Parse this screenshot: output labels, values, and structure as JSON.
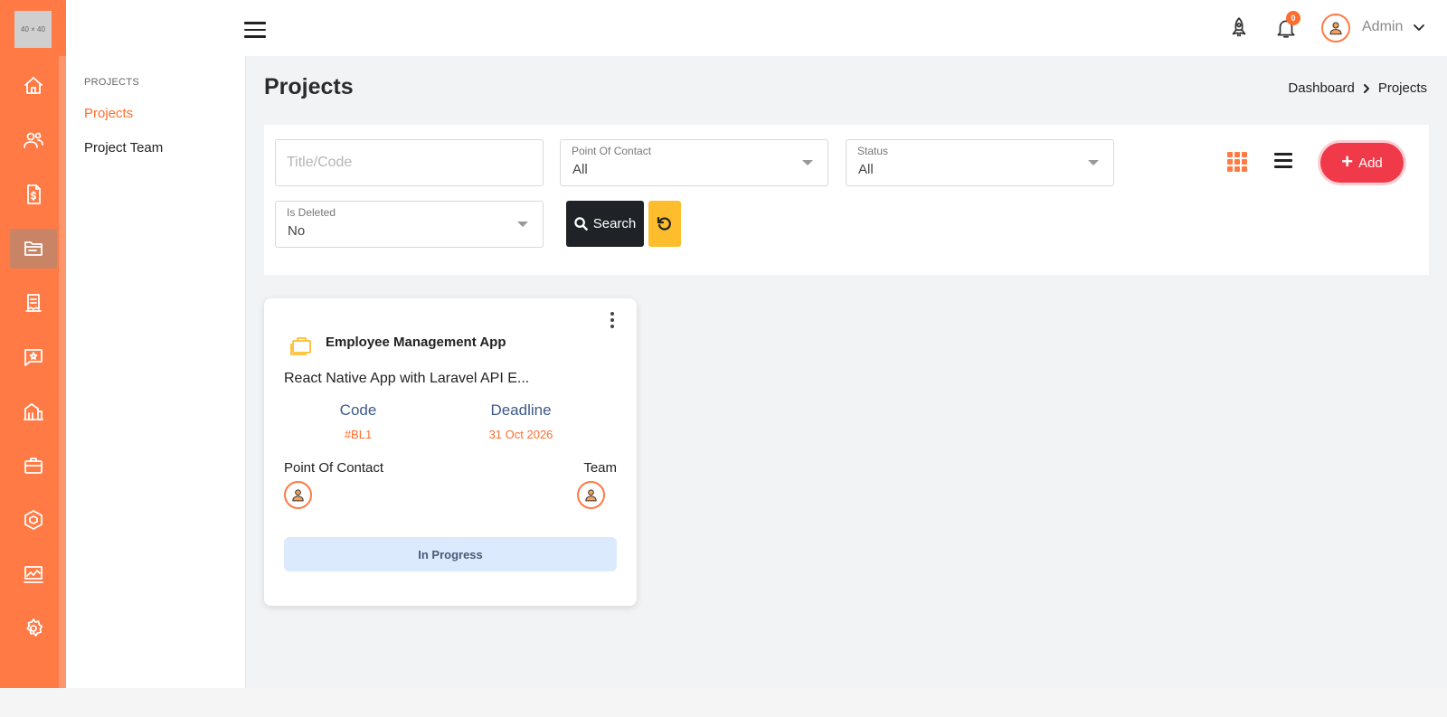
{
  "logo": {
    "text": "40 × 40"
  },
  "rail": {
    "items": [
      {
        "icon": "home-icon"
      },
      {
        "icon": "users-icon"
      },
      {
        "icon": "invoice-icon"
      },
      {
        "icon": "folder-icon"
      },
      {
        "icon": "receipt-icon"
      },
      {
        "icon": "message-icon"
      },
      {
        "icon": "building-icon"
      },
      {
        "icon": "briefcase-icon"
      },
      {
        "icon": "cube-icon"
      },
      {
        "icon": "chart-icon"
      },
      {
        "icon": "gear-icon"
      }
    ],
    "active_index": 3,
    "accent": "#ff7a45"
  },
  "subnav": {
    "heading": "PROJECTS",
    "items": [
      {
        "label": "Projects",
        "active": true
      },
      {
        "label": "Project Team",
        "active": false
      }
    ]
  },
  "topbar": {
    "notification_count": "0",
    "user_name": "Admin"
  },
  "page": {
    "title": "Projects",
    "breadcrumb": [
      "Dashboard",
      "Projects"
    ]
  },
  "filters": {
    "title_code": {
      "placeholder": "Title/Code",
      "value": ""
    },
    "point_of_contact": {
      "label": "Point Of Contact",
      "value": "All"
    },
    "status": {
      "label": "Status",
      "value": "All"
    },
    "is_deleted": {
      "label": "Is Deleted",
      "value": "No"
    },
    "search_label": "Search",
    "add_label": "Add"
  },
  "projects": [
    {
      "name": "Employee Management App",
      "description": "React Native App with Laravel API E...",
      "code_label": "Code",
      "code": "#BL1",
      "deadline_label": "Deadline",
      "deadline": "31 Oct 2026",
      "poc_label": "Point Of Contact",
      "team_label": "Team",
      "status": "In Progress"
    }
  ],
  "colors": {
    "accent": "#ff6d2d",
    "add_button": "#f03a4a",
    "reset_button": "#fdbd2c",
    "search_button": "#1f2226",
    "status_bg": "#dbeafd"
  }
}
